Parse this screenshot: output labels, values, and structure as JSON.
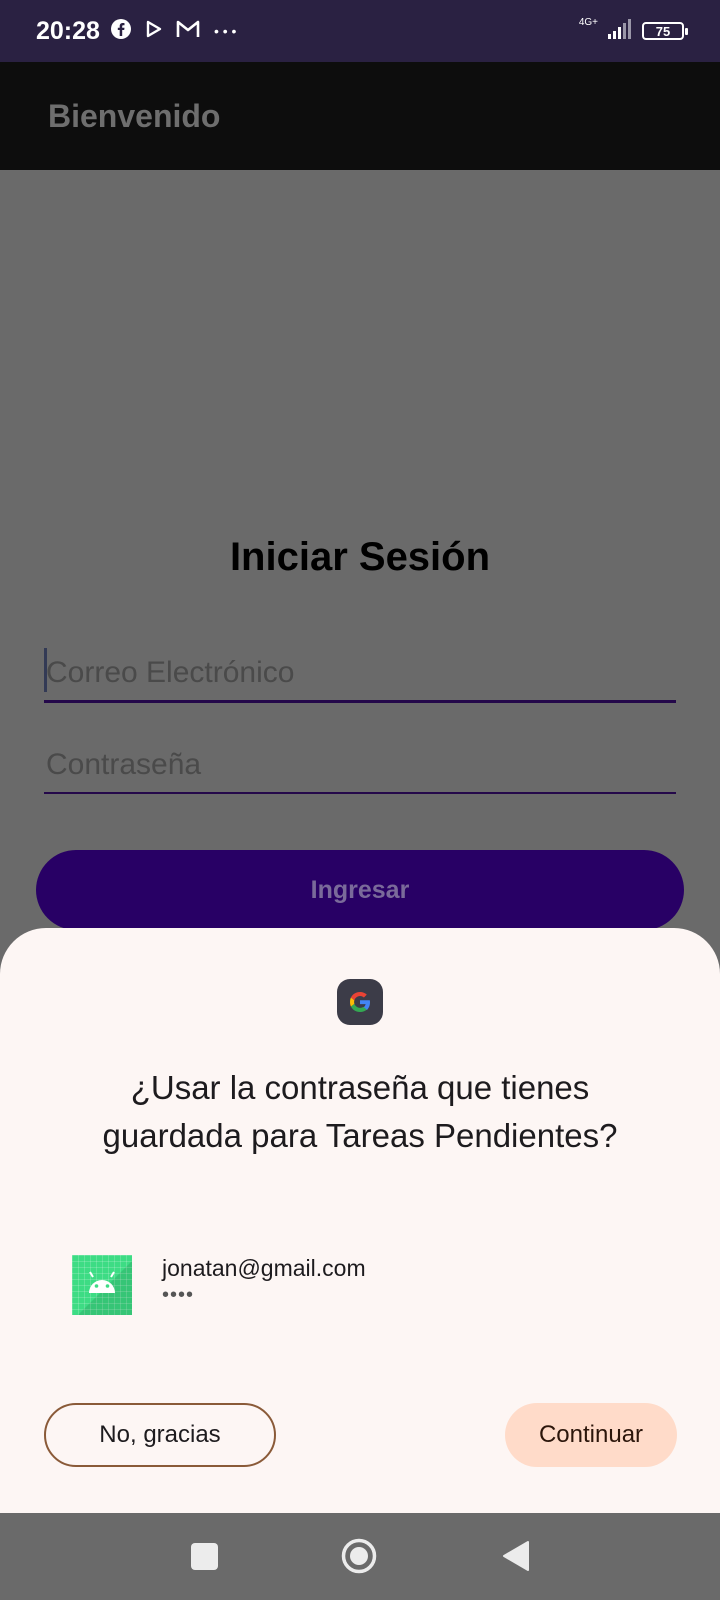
{
  "status_bar": {
    "time": "20:28",
    "left_icons": [
      "facebook-icon",
      "play-icon",
      "gmail-icon",
      "more-dots-icon"
    ],
    "more_dots": "• • •",
    "network": "4G+",
    "battery": "75"
  },
  "app_bar": {
    "title": "Bienvenido"
  },
  "login": {
    "title": "Iniciar Sesión",
    "email_placeholder": "Correo Electrónico",
    "password_placeholder": "Contraseña",
    "button_label": "Ingresar"
  },
  "sheet": {
    "icon": "google-icon",
    "title": "¿Usar la contraseña que tienes guardada para Tareas Pendientes?",
    "account": {
      "icon": "android-app-icon",
      "email": "jonatan@gmail.com",
      "password_mask": "••••"
    },
    "decline_label": "No, gracias",
    "continue_label": "Continuar"
  },
  "nav_bar": {
    "icons": [
      "recents-square-icon",
      "home-circle-icon",
      "back-triangle-icon"
    ]
  },
  "colors": {
    "status_bar": "#2a2142",
    "app_bar": "#0d0d0d",
    "scrim_background": "#6a6a6a",
    "primary_button": "#280065",
    "sheet_background": "#fdf6f4",
    "continue_button": "#ffdbc9",
    "decline_border": "#8a5a38"
  }
}
